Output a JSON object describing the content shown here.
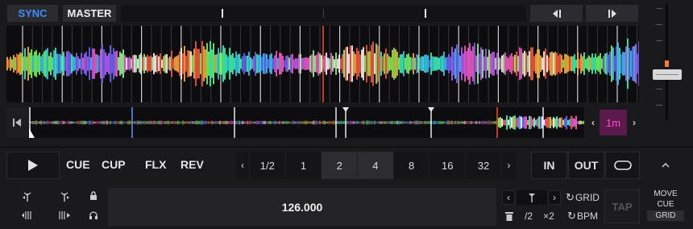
{
  "top": {
    "sync_label": "SYNC",
    "master_label": "MASTER",
    "nudge_back_icon": "skip-back-icon",
    "nudge_fwd_icon": "skip-forward-icon"
  },
  "overview": {
    "zoom_value": "1m"
  },
  "transport": {
    "cue_label": "CUE",
    "cup_label": "CUP",
    "flx_label": "FLX",
    "rev_label": "REV"
  },
  "loop": {
    "sizes": [
      "1/2",
      "1",
      "2",
      "4",
      "8",
      "16",
      "32"
    ],
    "active": "4",
    "in_label": "IN",
    "out_label": "OUT"
  },
  "grid": {
    "bpm_value": "126.000",
    "half_label": "/2",
    "double_label": "×2",
    "grid_label": "GRID",
    "bpm_label": "BPM",
    "tap_label": "TAP",
    "move_label": "MOVE",
    "cue_label": "CUE",
    "grid_mode_label": "GRID"
  },
  "colors": {
    "sync_blue": "#3b8fff",
    "playhead_red": "#ff4a3a",
    "zoom_magenta": "#ff4fd8",
    "fader_mark": "#ff7a3a"
  }
}
